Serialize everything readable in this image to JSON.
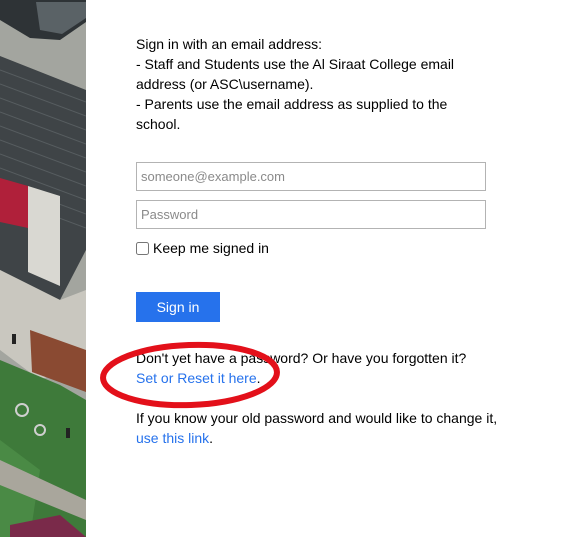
{
  "intro": {
    "line1": "Sign in with an email address:",
    "line2": "- Staff and Students use the Al Siraat College email address (or ASC\\username).",
    "line3": "- Parents use the email address as supplied to the school."
  },
  "form": {
    "email_placeholder": "someone@example.com",
    "password_placeholder": "Password",
    "keep_signed_in_label": "Keep me signed in",
    "keep_signed_in_checked": false,
    "signin_label": "Sign in",
    "button_color": "#2672ec"
  },
  "forgot": {
    "text": "Don't yet have a password? Or have you forgotten it?",
    "link_label": "Set or Reset it here",
    "suffix": "."
  },
  "change": {
    "text": "If you know your old password and would like to change it, ",
    "link_label": "use this link",
    "suffix": "."
  },
  "annotation": {
    "shape": "ellipse",
    "color": "#e3101a"
  },
  "colors": {
    "link": "#2672ec",
    "photo_roof": "#3f4447",
    "photo_grass": "#3e7a3a",
    "photo_accent": "#b0203a"
  }
}
